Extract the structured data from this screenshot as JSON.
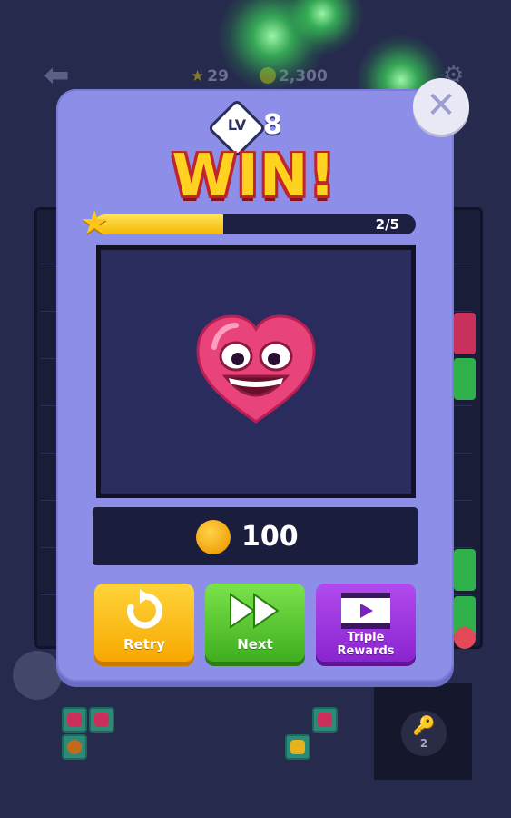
{
  "hud": {
    "stars": "29",
    "coins": "2,300"
  },
  "dialog": {
    "level_label": "LV",
    "level_number": "8",
    "title": "WIN!",
    "progress_text": "2/5",
    "progress_fraction": 0.4,
    "reward_amount": "100"
  },
  "buttons": {
    "retry": "Retry",
    "next": "Next",
    "triple": "Triple\nRewards"
  },
  "key": {
    "count": "2"
  },
  "colors": {
    "modal": "#8d8ee8",
    "win_text": "#ffd21f",
    "win_outline": "#c0242c",
    "retry": "#ffc21a",
    "next": "#5ac82f",
    "triple": "#9b35dd"
  }
}
